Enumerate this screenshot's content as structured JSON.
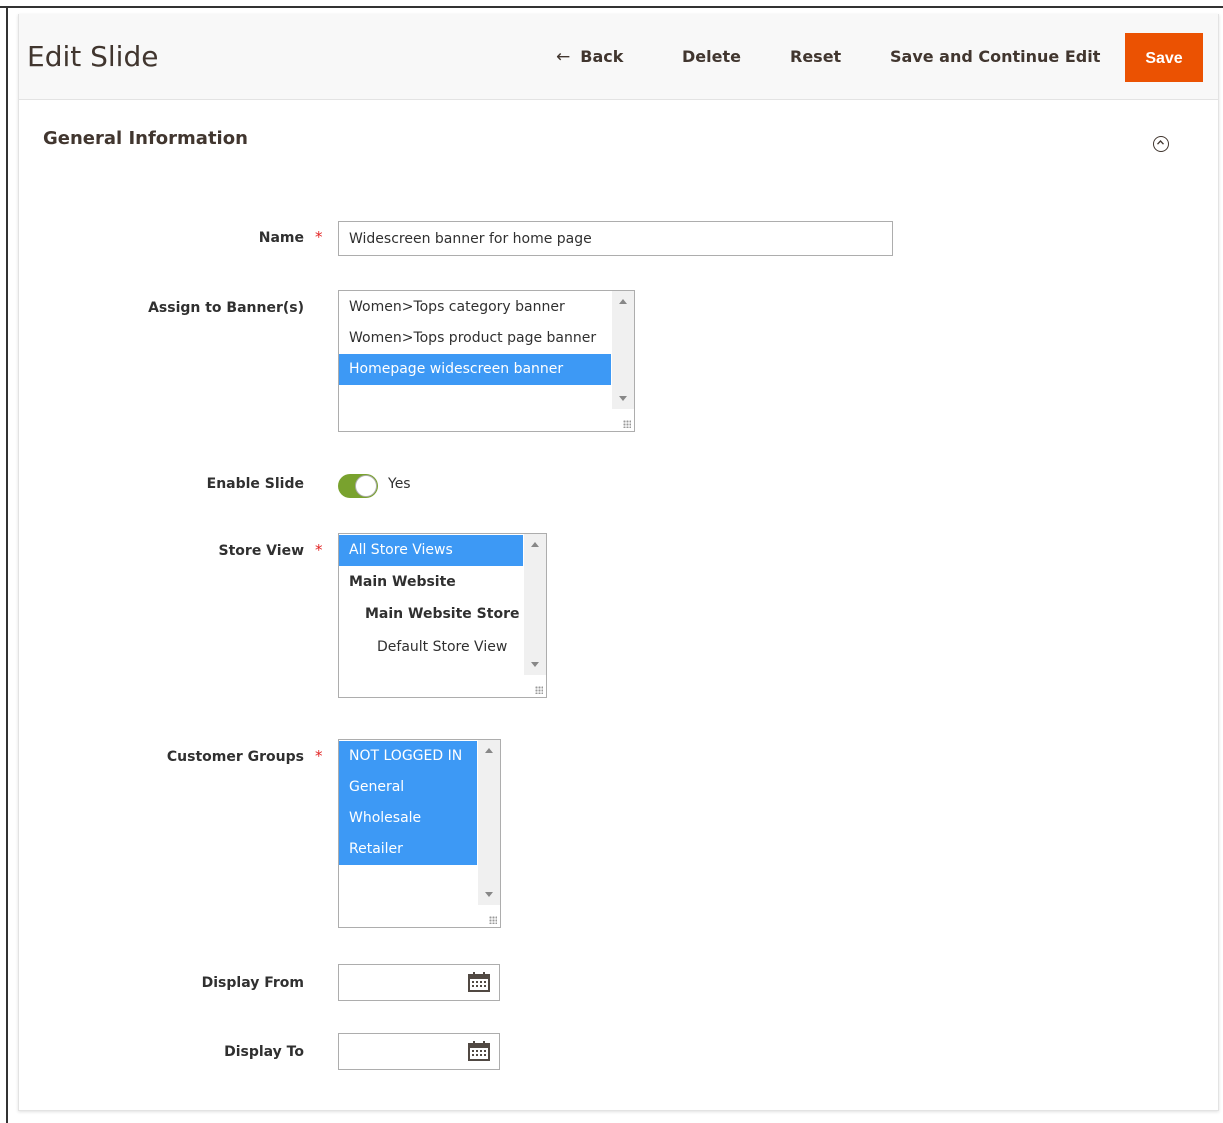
{
  "header": {
    "title": "Edit Slide",
    "back_label": "Back",
    "delete_label": "Delete",
    "reset_label": "Reset",
    "save_continue_label": "Save and Continue Edit",
    "save_label": "Save"
  },
  "section": {
    "title": "General Information",
    "collapse_icon": "circle-chevron-up-icon"
  },
  "form": {
    "name": {
      "label": "Name",
      "value": "Widescreen banner for home page",
      "required": true
    },
    "banners": {
      "label": "Assign to Banner(s)",
      "options": [
        "Women>Tops category banner",
        "Women>Tops product page banner",
        "Homepage widescreen banner"
      ],
      "selected": [
        "Homepage widescreen banner"
      ]
    },
    "enable_slide": {
      "label": "Enable Slide",
      "value_label": "Yes",
      "on": true
    },
    "store_view": {
      "label": "Store View",
      "required": true,
      "options": [
        "All Store Views",
        "Main Website",
        "Main Website Store",
        "Default Store View"
      ],
      "selected": [
        "All Store Views"
      ]
    },
    "customer_groups": {
      "label": "Customer Groups",
      "required": true,
      "options": [
        "NOT LOGGED IN",
        "General",
        "Wholesale",
        "Retailer"
      ],
      "selected": [
        "NOT LOGGED IN",
        "General",
        "Wholesale",
        "Retailer"
      ]
    },
    "display_from": {
      "label": "Display From",
      "value": ""
    },
    "display_to": {
      "label": "Display To",
      "value": ""
    },
    "required_mark": "*"
  },
  "colors": {
    "accent": "#eb5202",
    "selection": "#3d99f5",
    "toggle_on": "#79a22e",
    "required": "#e22626"
  }
}
